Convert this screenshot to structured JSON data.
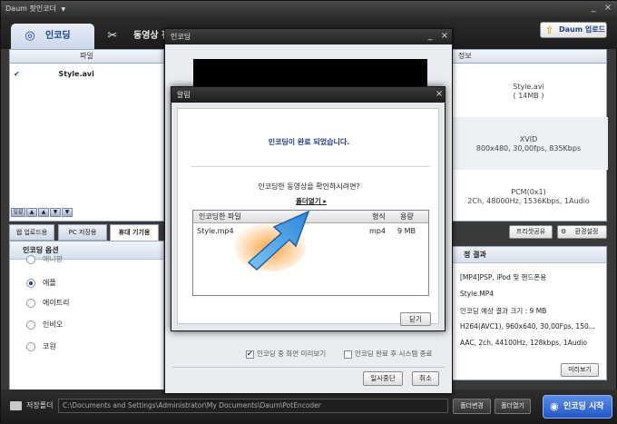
{
  "app": {
    "title": "Daum 팟인코더",
    "title_arrow": "▼",
    "minimize": "_",
    "close": "×"
  },
  "tabs": [
    {
      "label": "인코딩"
    },
    {
      "label": "동영상 편"
    }
  ],
  "upload_button": "Daum 업로드",
  "file_panel": {
    "header": "파일",
    "row": {
      "checked": true,
      "name": "Style.avi"
    }
  },
  "list_controls": [
    "일괄",
    "▲",
    "▲",
    "▼",
    "▼"
  ],
  "subtabs": [
    "웹 업로드용",
    "PC 저장용",
    "휴대 기기용"
  ],
  "options": {
    "title": "인코딩 옵션",
    "items": [
      "애니팡",
      "애플",
      "에이트리",
      "인비오",
      "코원"
    ],
    "selected": 1
  },
  "info": {
    "header": "정보",
    "file": "Style.avi",
    "size": "( 14MB )",
    "video_codec": "XVID",
    "video_detail": "800x480, 30,00fps, 835Kbps",
    "audio_codec": "PCM(0x1)",
    "audio_detail": "2Ch, 48000Hz, 1536Kbps, 1Audio"
  },
  "preset_buttons": {
    "share": "프리셋공유",
    "settings": "환경설정"
  },
  "result": {
    "title": "정 결과",
    "lines": [
      "[MP4]PSP, iPod 및 핸드폰용",
      "Style.MP4",
      "인코딩 예상 결과 크기 : 9 MB",
      "H264(AVC1), 960x640, 30,00Fps, 150...",
      "AAC, 2ch, 44100Hz, 128kbps, 1Audio"
    ],
    "preview_button": "미리보기"
  },
  "bottom": {
    "save_label": "저장폴더",
    "path": "C:\\Documents and Settings\\Administrator\\My Documents\\Daum\\PotEncoder",
    "change_button": "폴더변경",
    "open_button": "폴더열기",
    "start_button": "인코딩 시작"
  },
  "encode_dialog": {
    "title": "인코딩",
    "minimize": "_",
    "close": "×",
    "check_preview": {
      "label": "인코딩 중 화면 미리보기",
      "checked": true
    },
    "check_shutdown": {
      "label": "인코딩 완료 후 시스템 종료",
      "checked": false
    },
    "pause_button": "일시중단",
    "cancel_button": "취소"
  },
  "alert": {
    "title": "알림",
    "close": "×",
    "message": "인코딩이 완료 되었습니다.",
    "question": "인코딩한 동영상을 확인하시려면?",
    "open_folder": "폴더열기 ▸",
    "list": {
      "headers": [
        "인코딩한 파일",
        "형식",
        "용량"
      ],
      "rows": [
        {
          "file": "Style.mp4",
          "format": "mp4",
          "size": "9 MB"
        }
      ]
    },
    "close_button": "닫기"
  },
  "colors": {
    "accent": "#1c3f8a",
    "start": "#2456c4",
    "arrow": "#3f9ce8"
  }
}
